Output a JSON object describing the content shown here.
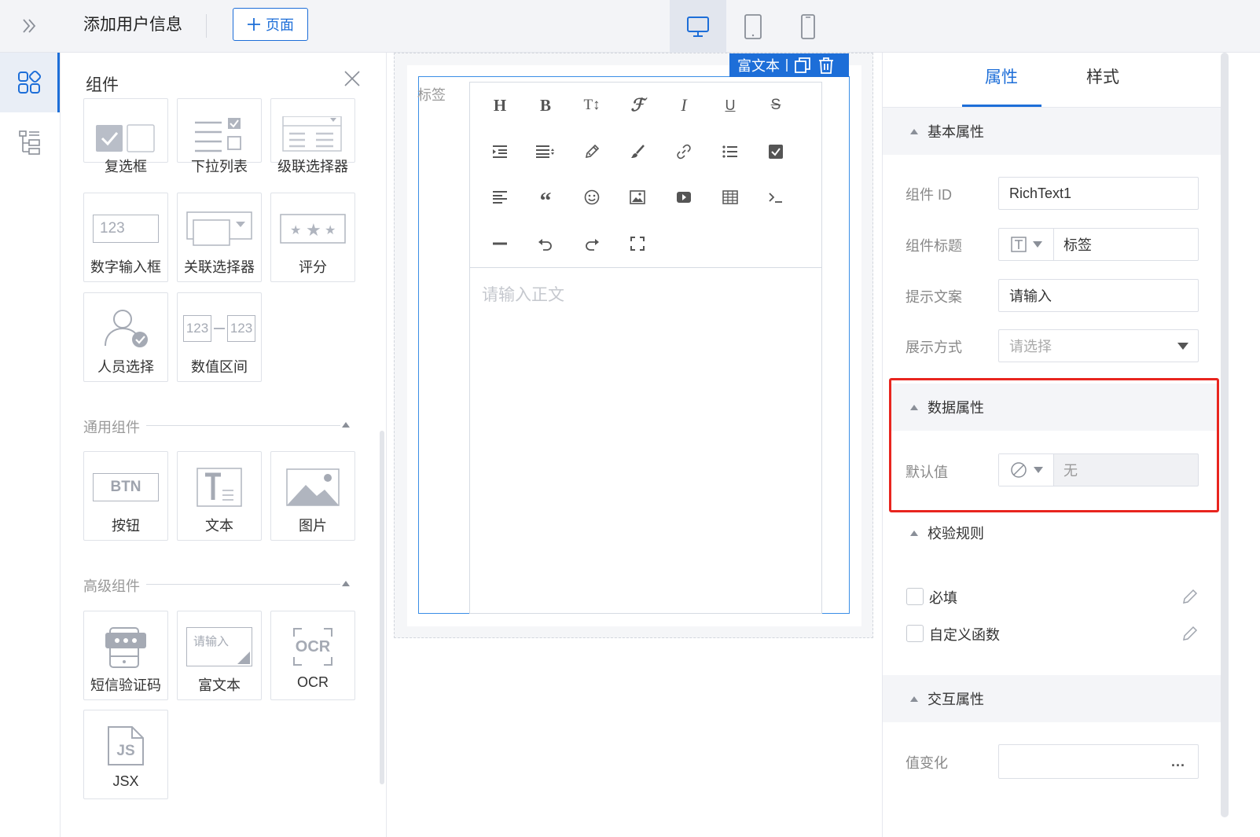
{
  "header": {
    "page_title": "添加用户信息",
    "add_page_label": "页面",
    "devices": [
      "desktop",
      "tablet",
      "mobile"
    ],
    "active_device": "desktop"
  },
  "rail": {
    "items": [
      {
        "icon": "components-grid-icon",
        "active": true
      },
      {
        "icon": "outline-tree-icon",
        "active": false
      }
    ]
  },
  "component_panel": {
    "title": "组件",
    "form_tiles": [
      {
        "icon": "checkbox-icon",
        "label": "复选框"
      },
      {
        "icon": "dropdown-list-icon",
        "label": "下拉列表"
      },
      {
        "icon": "cascader-icon",
        "label": "级联选择器"
      },
      {
        "icon": "number-input-icon",
        "label": "数字输入框",
        "icon_text": "123"
      },
      {
        "icon": "relation-select-icon",
        "label": "关联选择器"
      },
      {
        "icon": "rating-icon",
        "label": "评分"
      },
      {
        "icon": "user-select-icon",
        "label": "人员选择"
      },
      {
        "icon": "number-range-icon",
        "label": "数值区间",
        "icon_text": "123"
      }
    ],
    "common_section": "通用组件",
    "common_tiles": [
      {
        "icon": "button-icon",
        "label": "按钮",
        "icon_text": "BTN"
      },
      {
        "icon": "text-icon",
        "label": "文本"
      },
      {
        "icon": "image-icon",
        "label": "图片"
      }
    ],
    "advanced_section": "高级组件",
    "advanced_tiles": [
      {
        "icon": "sms-code-icon",
        "label": "短信验证码"
      },
      {
        "icon": "rich-text-icon",
        "label": "富文本",
        "icon_text": "请输入"
      },
      {
        "icon": "ocr-icon",
        "label": "OCR",
        "icon_text": "OCR"
      },
      {
        "icon": "jsx-icon",
        "label": "JSX",
        "icon_text": "JS"
      }
    ]
  },
  "canvas": {
    "component_tag": "富文本",
    "field_label": "标签",
    "editor_placeholder": "请输入正文",
    "toolbar": [
      "heading",
      "bold",
      "font-size",
      "font-family",
      "italic",
      "underline",
      "strikethrough",
      "indent",
      "line-height",
      "fore-color",
      "back-color",
      "link",
      "list",
      "todo",
      "justify",
      "quote",
      "emoticon",
      "image",
      "video",
      "table",
      "code",
      "divider",
      "undo",
      "redo",
      "fullscreen"
    ]
  },
  "properties": {
    "tabs": [
      {
        "label": "属性",
        "active": true
      },
      {
        "label": "样式",
        "active": false
      }
    ],
    "basic": {
      "title": "基本属性",
      "id_label": "组件 ID",
      "id_value": "RichText1",
      "title_label": "组件标题",
      "title_value": "标签",
      "hint_label": "提示文案",
      "hint_value": "请输入",
      "display_label": "展示方式",
      "display_placeholder": "请选择"
    },
    "data": {
      "title": "数据属性",
      "default_label": "默认值",
      "default_value": "无"
    },
    "validation": {
      "title": "校验规则",
      "required_label": "必填",
      "custom_label": "自定义函数"
    },
    "interaction": {
      "title": "交互属性",
      "change_label": "值变化",
      "more_label": "..."
    }
  },
  "colors": {
    "primary": "#1d6ed8",
    "highlight": "#e8251f",
    "section_bg": "#f4f5f8"
  }
}
